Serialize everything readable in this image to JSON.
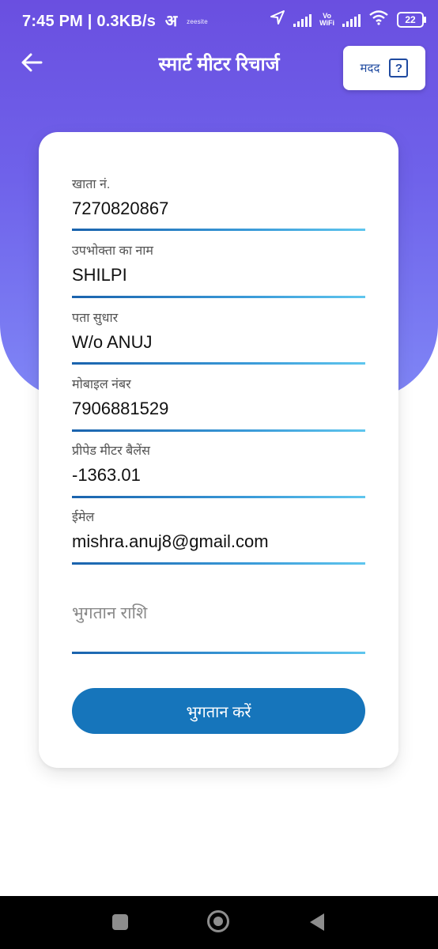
{
  "status_bar": {
    "time": "7:45 PM",
    "speed": "0.3KB/s",
    "app_glyph": "अ",
    "app_brand": "zeesite",
    "vowifi_top": "Vo",
    "vowifi_bottom": "WiFi",
    "battery": "22"
  },
  "app_bar": {
    "title": "स्मार्ट मीटर रिचार्ज",
    "help_label": "मदद",
    "help_icon_glyph": "?"
  },
  "form": {
    "fields": [
      {
        "label": "खाता नं.",
        "value": "7270820867"
      },
      {
        "label": "उपभोक्ता का नाम",
        "value": "SHILPI"
      },
      {
        "label": "पता सुधार",
        "value": "W/o ANUJ"
      },
      {
        "label": "मोबाइल नंबर",
        "value": "7906881529"
      },
      {
        "label": "प्रीपेड मीटर बैलेंस",
        "value": "-1363.01"
      },
      {
        "label": "ईमेल",
        "value": "mishra.anuj8@gmail.com"
      }
    ],
    "amount": {
      "placeholder": "भुगतान राशि",
      "value": ""
    },
    "pay_button": "भुगतान करें"
  },
  "icons": {
    "back": "arrow-left-icon",
    "help": "question-box-icon",
    "location": "navigation-arrow-icon",
    "wifi": "wifi-icon",
    "battery": "battery-icon"
  },
  "colors": {
    "header_top": "#6a4fe0",
    "header_bottom": "#7f86f6",
    "button": "#1675bb",
    "underline_start": "#1a63ad",
    "underline_end": "#5fc6ee"
  }
}
